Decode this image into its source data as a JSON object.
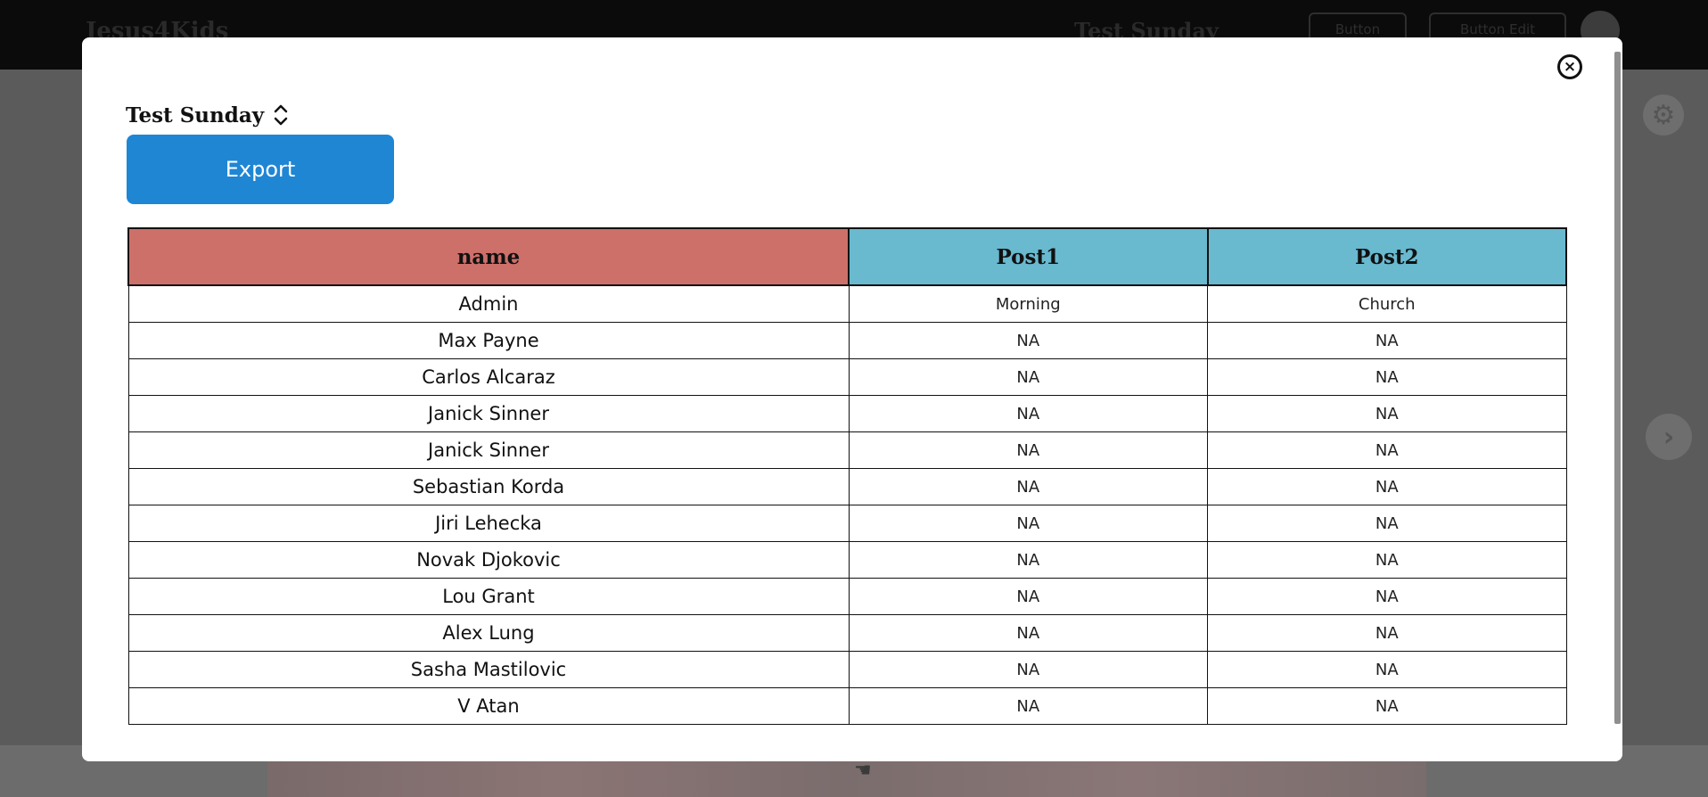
{
  "background": {
    "app_logo": "Jesus4Kids",
    "event_name": "Test Sunday",
    "buttons": [
      "Button",
      "Button Edit"
    ]
  },
  "modal": {
    "close_label": "×",
    "event_select": {
      "value": "Test Sunday"
    },
    "export_label": "Export",
    "table": {
      "columns": [
        "name",
        "Post1",
        "Post2"
      ],
      "rows": [
        {
          "name": "Admin",
          "post1": "Morning",
          "post2": "Church"
        },
        {
          "name": "Max Payne",
          "post1": "NA",
          "post2": "NA"
        },
        {
          "name": "Carlos Alcaraz",
          "post1": "NA",
          "post2": "NA"
        },
        {
          "name": "Janick Sinner",
          "post1": "NA",
          "post2": "NA"
        },
        {
          "name": "Janick Sinner",
          "post1": "NA",
          "post2": "NA"
        },
        {
          "name": "Sebastian Korda",
          "post1": "NA",
          "post2": "NA"
        },
        {
          "name": "Jiri Lehecka",
          "post1": "NA",
          "post2": "NA"
        },
        {
          "name": "Novak Djokovic",
          "post1": "NA",
          "post2": "NA"
        },
        {
          "name": "Lou Grant",
          "post1": "NA",
          "post2": "NA"
        },
        {
          "name": "Alex Lung",
          "post1": "NA",
          "post2": "NA"
        },
        {
          "name": "Sasha Mastilovic",
          "post1": "NA",
          "post2": "NA"
        },
        {
          "name": "V Atan",
          "post1": "NA",
          "post2": "NA"
        }
      ]
    }
  },
  "colors": {
    "name_header": "#cd706a",
    "post_header": "#69b9cf",
    "export_button": "#1f86d4"
  },
  "icons": [
    "close-icon",
    "chevron-up-down-icon",
    "settings-icon",
    "chevron-right-icon",
    "pointer-icon"
  ]
}
